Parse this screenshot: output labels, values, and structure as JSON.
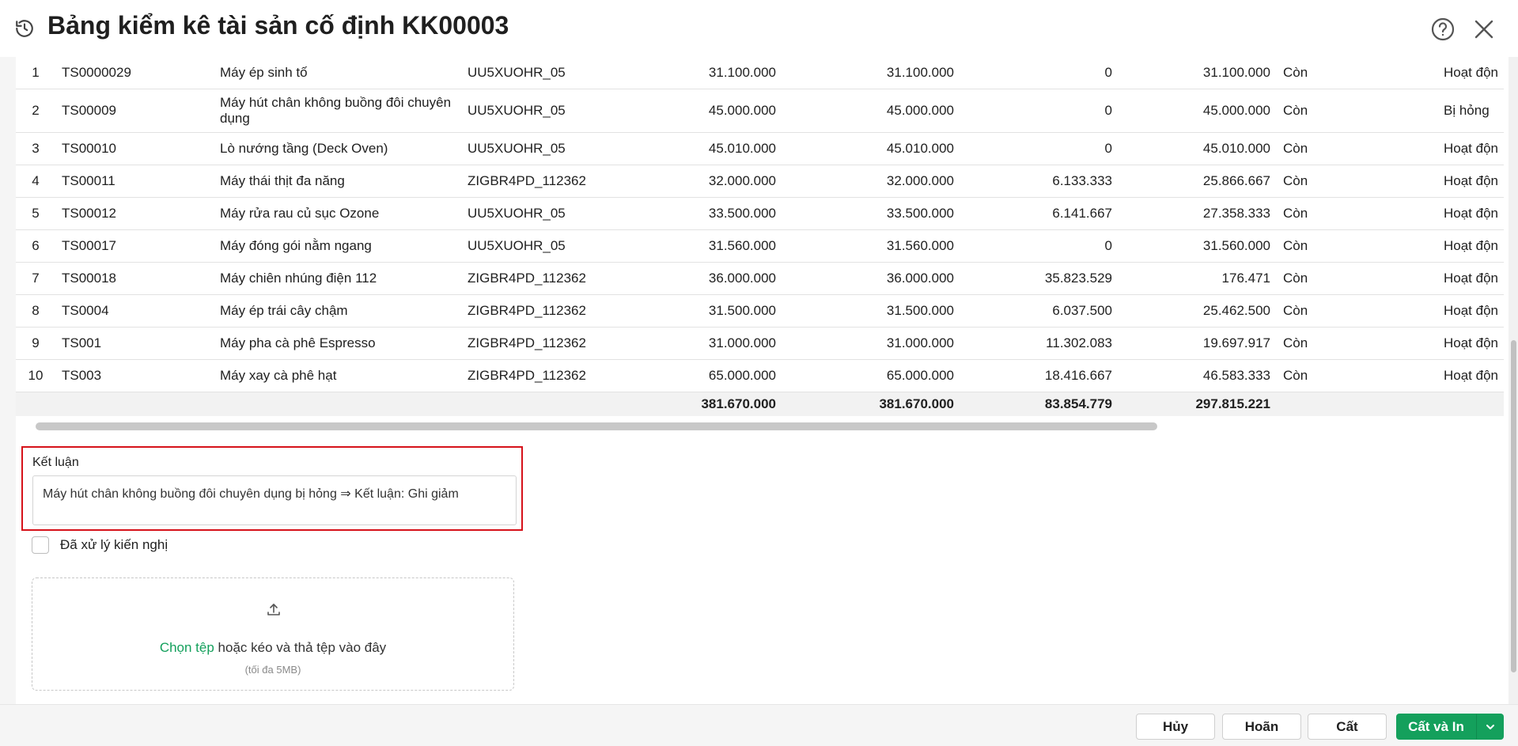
{
  "header": {
    "title": "Bảng kiểm kê tài sản cố định KK00003",
    "icons": [
      "history-icon",
      "help-icon",
      "close-icon"
    ]
  },
  "table": {
    "rows": [
      {
        "stt": "1",
        "code": "TS0000029",
        "name": "Máy ép sinh tố",
        "dept": "UU5XUOHR_05",
        "orig": "31.100.000",
        "orig2": "31.100.000",
        "depr": "0",
        "remain": "31.100.000",
        "status": "Còn",
        "state": "Hoạt độn"
      },
      {
        "stt": "2",
        "code": "TS00009",
        "name": "Máy hút chân không buồng đôi chuyên dụng",
        "dept": "UU5XUOHR_05",
        "orig": "45.000.000",
        "orig2": "45.000.000",
        "depr": "0",
        "remain": "45.000.000",
        "status": "Còn",
        "state": "Bị hỏng"
      },
      {
        "stt": "3",
        "code": "TS00010",
        "name": "Lò nướng tầng (Deck Oven)",
        "dept": "UU5XUOHR_05",
        "orig": "45.010.000",
        "orig2": "45.010.000",
        "depr": "0",
        "remain": "45.010.000",
        "status": "Còn",
        "state": "Hoạt độn"
      },
      {
        "stt": "4",
        "code": "TS00011",
        "name": "Máy thái thịt đa năng",
        "dept": "ZIGBR4PD_112362",
        "orig": "32.000.000",
        "orig2": "32.000.000",
        "depr": "6.133.333",
        "remain": "25.866.667",
        "status": "Còn",
        "state": "Hoạt độn"
      },
      {
        "stt": "5",
        "code": "TS00012",
        "name": "Máy rửa rau củ sục Ozone",
        "dept": "UU5XUOHR_05",
        "orig": "33.500.000",
        "orig2": "33.500.000",
        "depr": "6.141.667",
        "remain": "27.358.333",
        "status": "Còn",
        "state": "Hoạt độn"
      },
      {
        "stt": "6",
        "code": "TS00017",
        "name": "Máy đóng gói nằm ngang",
        "dept": "UU5XUOHR_05",
        "orig": "31.560.000",
        "orig2": "31.560.000",
        "depr": "0",
        "remain": "31.560.000",
        "status": "Còn",
        "state": "Hoạt độn"
      },
      {
        "stt": "7",
        "code": "TS00018",
        "name": "Máy chiên nhúng điện 112",
        "dept": "ZIGBR4PD_112362",
        "orig": "36.000.000",
        "orig2": "36.000.000",
        "depr": "35.823.529",
        "remain": "176.471",
        "status": "Còn",
        "state": "Hoạt độn"
      },
      {
        "stt": "8",
        "code": "TS0004",
        "name": "Máy ép trái cây chậm",
        "dept": "ZIGBR4PD_112362",
        "orig": "31.500.000",
        "orig2": "31.500.000",
        "depr": "6.037.500",
        "remain": "25.462.500",
        "status": "Còn",
        "state": "Hoạt độn"
      },
      {
        "stt": "9",
        "code": "TS001",
        "name": "Máy pha cà phê Espresso",
        "dept": "ZIGBR4PD_112362",
        "orig": "31.000.000",
        "orig2": "31.000.000",
        "depr": "11.302.083",
        "remain": "19.697.917",
        "status": "Còn",
        "state": "Hoạt độn"
      },
      {
        "stt": "10",
        "code": "TS003",
        "name": "Máy xay cà phê hạt",
        "dept": "ZIGBR4PD_112362",
        "orig": "65.000.000",
        "orig2": "65.000.000",
        "depr": "18.416.667",
        "remain": "46.583.333",
        "status": "Còn",
        "state": "Hoạt độn"
      }
    ],
    "totals": {
      "orig": "381.670.000",
      "orig2": "381.670.000",
      "depr": "83.854.779",
      "remain": "297.815.221"
    }
  },
  "conclusion": {
    "label": "Kết luận",
    "value": "Máy hút chân không buồng đôi chuyên dụng bị hỏng ⇒ Kết luận: Ghi giảm"
  },
  "recommendation": {
    "label": "Đã xử lý kiến nghị",
    "checked": false
  },
  "upload": {
    "link": "Chọn tệp",
    "text": " hoặc kéo và thả tệp vào đây",
    "hint": "(tối đa 5MB)"
  },
  "footer": {
    "cancel": "Hủy",
    "undo": "Hoãn",
    "save": "Cất",
    "save_print": "Cất và In"
  },
  "colors": {
    "primary": "#14a05c",
    "highlight_border": "#d6121a"
  }
}
